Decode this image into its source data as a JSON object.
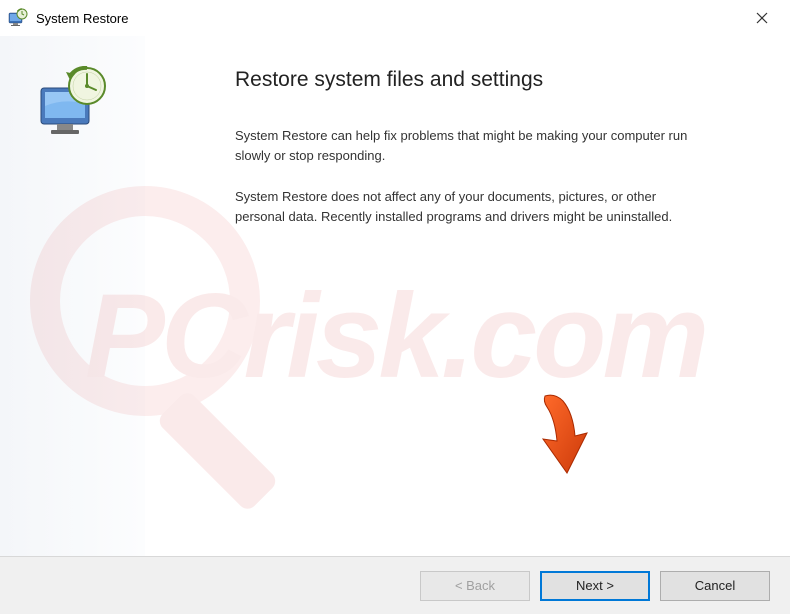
{
  "titlebar": {
    "title": "System Restore"
  },
  "content": {
    "heading": "Restore system files and settings",
    "para1": "System Restore can help fix problems that might be making your computer run slowly or stop responding.",
    "para2": "System Restore does not affect any of your documents, pictures, or other personal data. Recently installed programs and drivers might be uninstalled."
  },
  "buttons": {
    "back": "< Back",
    "next": "Next >",
    "cancel": "Cancel"
  }
}
